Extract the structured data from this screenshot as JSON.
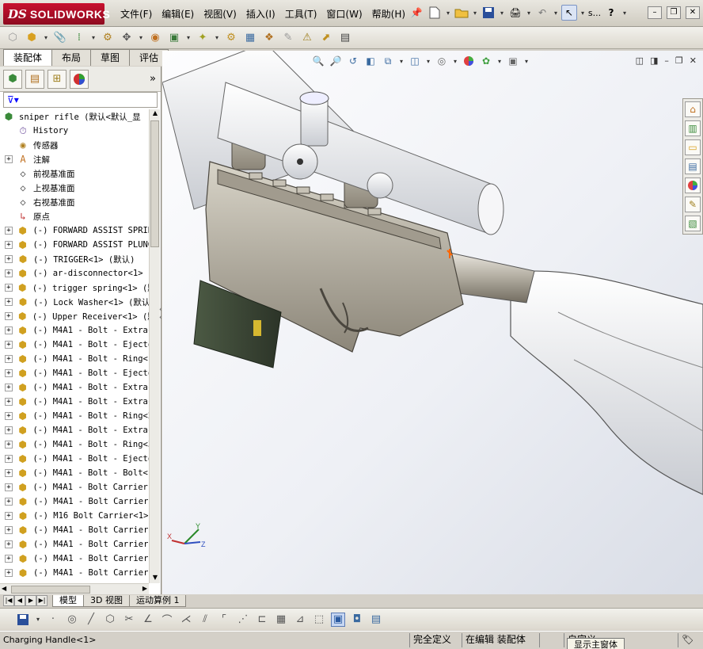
{
  "app": {
    "brand_prefix": "DS",
    "brand_name": "SOLIDWORKS"
  },
  "menu": [
    {
      "key": "file",
      "label": "文件(F)"
    },
    {
      "key": "edit",
      "label": "编辑(E)"
    },
    {
      "key": "view",
      "label": "视图(V)"
    },
    {
      "key": "insert",
      "label": "插入(I)"
    },
    {
      "key": "tools",
      "label": "工具(T)"
    },
    {
      "key": "window",
      "label": "窗口(W)"
    },
    {
      "key": "help",
      "label": "帮助(H)"
    }
  ],
  "toolbar_ellipsis": "s...",
  "help_icon": "?",
  "cm_tabs": [
    {
      "label": "装配体",
      "active": true
    },
    {
      "label": "布局",
      "active": false
    },
    {
      "label": "草图",
      "active": false
    },
    {
      "label": "评估",
      "active": false
    }
  ],
  "fm": {
    "expand_glyph": "»",
    "root_label": "sniper rifle (默认<默认_显",
    "items": [
      {
        "label": "History",
        "icon": "history-icon",
        "expand": false
      },
      {
        "label": "传感器",
        "icon": "sensor-icon",
        "expand": false
      },
      {
        "label": "注解",
        "icon": "annotation-icon",
        "expand": true
      },
      {
        "label": "前视基准面",
        "icon": "plane-icon",
        "expand": false
      },
      {
        "label": "上视基准面",
        "icon": "plane-icon",
        "expand": false
      },
      {
        "label": "右视基准面",
        "icon": "plane-icon",
        "expand": false
      },
      {
        "label": "原点",
        "icon": "origin-icon",
        "expand": false
      },
      {
        "label": "(-) FORWARD ASSIST SPRIN",
        "icon": "part-icon",
        "expand": true
      },
      {
        "label": "(-) FORWARD ASSIST PLUNG",
        "icon": "part-icon",
        "expand": true
      },
      {
        "label": "(-) TRIGGER<1> (默认)",
        "icon": "part-icon",
        "expand": true
      },
      {
        "label": "(-) ar-disconnector<1> (",
        "icon": "part-icon",
        "expand": true
      },
      {
        "label": "(-) trigger spring<1> (默",
        "icon": "part-icon",
        "expand": true
      },
      {
        "label": "(-) Lock Washer<1> (默认",
        "icon": "part-icon",
        "expand": true
      },
      {
        "label": "(-) Upper Receiver<1> (默",
        "icon": "part-icon",
        "expand": true
      },
      {
        "label": "(-) M4A1 - Bolt - Extrac",
        "icon": "part-icon",
        "expand": true
      },
      {
        "label": "(-) M4A1 - Bolt - Ejecto",
        "icon": "part-icon",
        "expand": true
      },
      {
        "label": "(-) M4A1 - Bolt - Ring<1",
        "icon": "part-icon",
        "expand": true
      },
      {
        "label": "(-) M4A1 - Bolt - Ejecto",
        "icon": "part-icon",
        "expand": true
      },
      {
        "label": "(-) M4A1 - Bolt - Extrac",
        "icon": "part-icon",
        "expand": true
      },
      {
        "label": "(-) M4A1 - Bolt - Extrac",
        "icon": "part-icon",
        "expand": true
      },
      {
        "label": "(-) M4A1 - Bolt - Ring<2",
        "icon": "part-icon",
        "expand": true
      },
      {
        "label": "(-) M4A1 - Bolt - Extrac",
        "icon": "part-icon",
        "expand": true
      },
      {
        "label": "(-) M4A1 - Bolt - Ring<3",
        "icon": "part-icon",
        "expand": true
      },
      {
        "label": "(-) M4A1 - Bolt - Ejecto",
        "icon": "part-icon",
        "expand": true
      },
      {
        "label": "(-) M4A1 - Bolt - Bolt<1",
        "icon": "part-icon",
        "expand": true
      },
      {
        "label": "(-) M4A1 - Bolt Carrier-",
        "icon": "part-icon",
        "expand": true
      },
      {
        "label": "(-) M4A1 - Bolt Carrier",
        "icon": "part-icon",
        "expand": true
      },
      {
        "label": "(-) M16 Bolt Carrier<1>",
        "icon": "part-icon",
        "expand": true
      },
      {
        "label": "(-) M4A1 - Bolt Carrier",
        "icon": "part-icon",
        "expand": true
      },
      {
        "label": "(-) M4A1 - Bolt Carrier",
        "icon": "part-icon",
        "expand": true
      },
      {
        "label": "(-) M4A1 - Bolt Carrier",
        "icon": "part-icon",
        "expand": true
      },
      {
        "label": "(-) M4A1 - Bolt Carrier",
        "icon": "part-icon",
        "expand": true
      }
    ]
  },
  "model_tabs": [
    {
      "label": "模型",
      "active": true
    },
    {
      "label": "3D 视图",
      "active": false
    },
    {
      "label": "运动算例 1",
      "active": false
    }
  ],
  "status": {
    "selection": "Charging Handle<1>",
    "definition": "完全定义",
    "mode": "在编辑 装配体",
    "custom": "自定义"
  },
  "tooltip": "显示主窗体",
  "triad": {
    "x": "X",
    "y": "Y",
    "z": "Z"
  },
  "colors": {
    "brand_red": "#c8102e",
    "viewport_bg": "#eef0f5",
    "selection_blue": "#c7d7f2"
  }
}
